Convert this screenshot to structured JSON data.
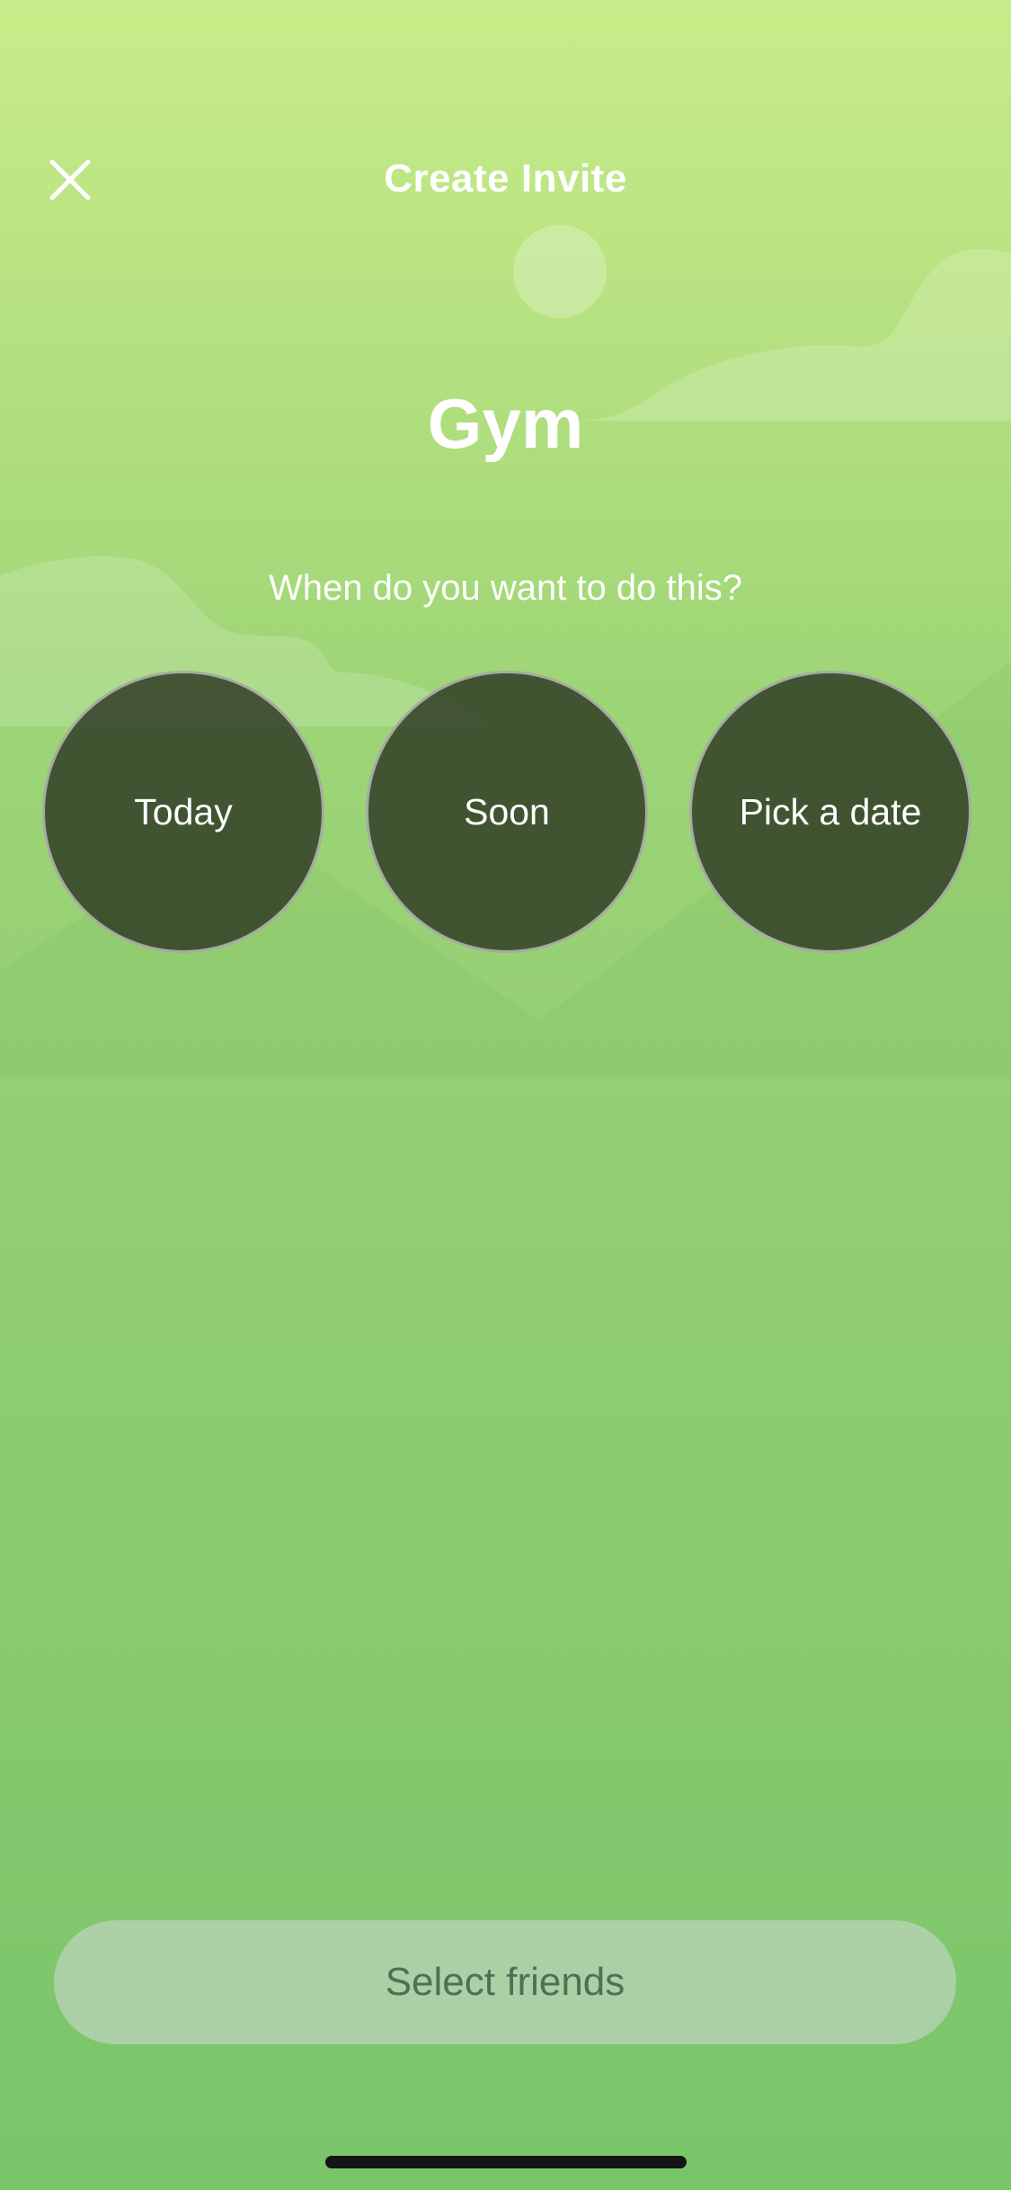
{
  "header": {
    "title": "Create Invite",
    "close_icon": "close-icon"
  },
  "activity": {
    "name": "Gym"
  },
  "prompt": {
    "question": "When do you want to do this?"
  },
  "options": [
    {
      "label": "Today"
    },
    {
      "label": "Soon"
    },
    {
      "label": "Pick a date"
    }
  ],
  "footer": {
    "select_friends_label": "Select friends"
  },
  "colors": {
    "background_top": "#c9ec89",
    "background_bottom": "#79c56a",
    "option_fill": "#344228",
    "button_text": "#4d7153"
  }
}
